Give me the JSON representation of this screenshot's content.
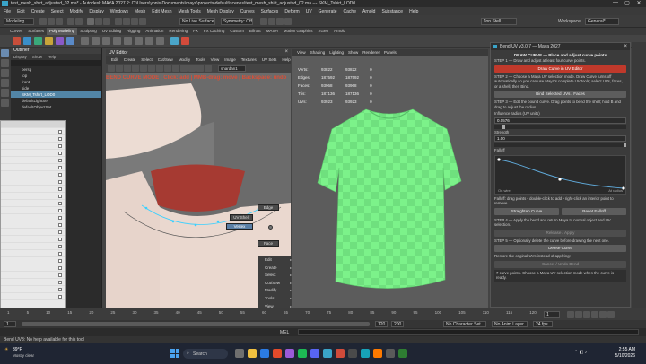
{
  "window": {
    "title": "test_mesh_shirt_adjusted_02.ma* - Autodesk MAYA 2027.2: C:\\Users\\yonis\\Documents\\maya\\projects\\default\\scenes\\test_mesh_shirt_adjusted_02.ma --- SKM_Tshirt_LOD0",
    "minimize": "—",
    "maximize": "▢",
    "close": "✕"
  },
  "menubar": [
    "File",
    "Edit",
    "Create",
    "Select",
    "Modify",
    "Display",
    "Windows",
    "Mesh",
    "Edit Mesh",
    "Mesh Tools",
    "Mesh Display",
    "Curves",
    "Surfaces",
    "Deform",
    "UV",
    "Generate",
    "Cache",
    "Arnold",
    "Substance",
    "Help"
  ],
  "statusline": {
    "mode": "Modeling",
    "no_live_surface": "No Live Surface",
    "symmetry": "Symmetry: Off",
    "sign_in": "Jon Stell",
    "workspace_label": "Workspace:",
    "workspace_value": "General*"
  },
  "shelf_tabs": [
    "Curves",
    "Surfaces",
    "Poly Modeling",
    "Sculpting",
    "UV Editing",
    "Rigging",
    "Animation",
    "Rendering",
    "FX",
    "FX Caching",
    "Custom",
    "Bifrost",
    "MASH",
    "Motion Graphics",
    "XGen",
    "Arnold"
  ],
  "shelf_active": "Poly Modeling",
  "outliner": {
    "title": "Outliner",
    "menus": [
      "Display",
      "Show",
      "Help"
    ],
    "items": [
      "persp",
      "top",
      "front",
      "side",
      "SKM_Tshirt_LOD0",
      "defaultLightSet",
      "defaultObjectSet"
    ],
    "selected_index": 4
  },
  "uv_editor": {
    "title": "UV Editor",
    "menus": [
      "Edit",
      "Create",
      "Select",
      "Cut/Sew",
      "Modify",
      "Tools",
      "View",
      "Image",
      "Textures",
      "UV Sets",
      "Help"
    ],
    "banner": "BEND CURVE MODE | Click: add | MMB-drag: move | Backspace: undo",
    "map_dropdown": "shardan1"
  },
  "viewport": {
    "menus": [
      "View",
      "Shading",
      "Lighting",
      "Show",
      "Renderer",
      "Panels"
    ],
    "hud": [
      {
        "label": "Verts:",
        "a": "93822",
        "b": "93822",
        "c": "0"
      },
      {
        "label": "Edges:",
        "a": "187592",
        "b": "187592",
        "c": "0"
      },
      {
        "label": "Faces:",
        "a": "93968",
        "b": "93968",
        "c": "0"
      },
      {
        "label": "Tris:",
        "a": "187136",
        "b": "187136",
        "c": "0"
      },
      {
        "label": "UVs:",
        "a": "93923",
        "b": "93923",
        "c": "0"
      }
    ]
  },
  "marking_menu": {
    "uv_shell": "UV Shell",
    "vertex": "Vertex",
    "uv": "UV",
    "edge": "Edge",
    "face": "Face",
    "items": [
      "Edit",
      "Create",
      "Select",
      "Cut/Sew",
      "Modify",
      "Tools",
      "View",
      "Image",
      "Textures",
      "UV Sets"
    ]
  },
  "bend_panel": {
    "title": "Bend UV v3.0.7 — Maya 2027",
    "heading": "DRAW CURVE — Place and adjust curve points",
    "step1_title": "STEP 1 — Draw and adjust at least four curve points.",
    "draw_btn": "Draw Curve in UV Editor",
    "step2_title": "STEP 2 — Choose a Maya UV selection mode. Draw Curve turns off automatically so you can use Maya's complete UV tools; select UVs, faces, or a shell, then Bind.",
    "bind_btn": "Bind Selected UVs / Faces",
    "step3_title": "STEP 3 — Edit the bound curve. Drag points to bend the shell; hold B and drag to adjust the radius.",
    "radius_label": "Influence radius (UV units)",
    "radius_value": "0.0576",
    "strength_label": "Strength",
    "strength_value": "1.00",
    "falloff_label": "Falloff",
    "on_wire": "On wire",
    "at_radius": "At radius",
    "falloff_hint": "Falloff: drag points • double-click to add • right-click an interior point to remove",
    "straighten_btn": "Straighten Curve",
    "reset_btn": "Reset Falloff",
    "step4_title": "STEP 4 — Apply the bend and return Maya to normal object and UV selection.",
    "apply_btn": "Release / Apply",
    "step5_title": "STEP 5 — Optionally delete the curve before drawing the next one.",
    "delete_btn": "Delete Curve",
    "restore_title": "Restore the original UVs instead of applying:",
    "cancel_btn": "Cancel / Undo Bend",
    "footer": "7 curve points. Choose a Maya UV selection mode when the curve is ready."
  },
  "timeline": {
    "ticks": [
      "1",
      "5",
      "10",
      "15",
      "20",
      "25",
      "30",
      "35",
      "40",
      "45",
      "50",
      "55",
      "60",
      "65",
      "70",
      "75",
      "80",
      "85",
      "90",
      "95",
      "100",
      "105",
      "110",
      "115",
      "120"
    ],
    "current_frame": "1",
    "range_start": "1",
    "range_end": "120",
    "playback_end": "200",
    "no_character_set": "No Character Set",
    "no_anim_layer": "No Anim Layer",
    "fps": "24 fps"
  },
  "cmdline": {
    "lang": "MEL"
  },
  "helpline": {
    "text": "Bend UV3: No help available for this tool"
  },
  "taskbar": {
    "weather_temp": "39°F",
    "weather_text": "Mostly clear",
    "search": "Search",
    "time": "2:55 AM",
    "date": "5/10/2026"
  },
  "colors": {
    "accent_red": "#c0392b",
    "mesh_green": "#7cf28a",
    "outliner_select": "#5285a6"
  }
}
